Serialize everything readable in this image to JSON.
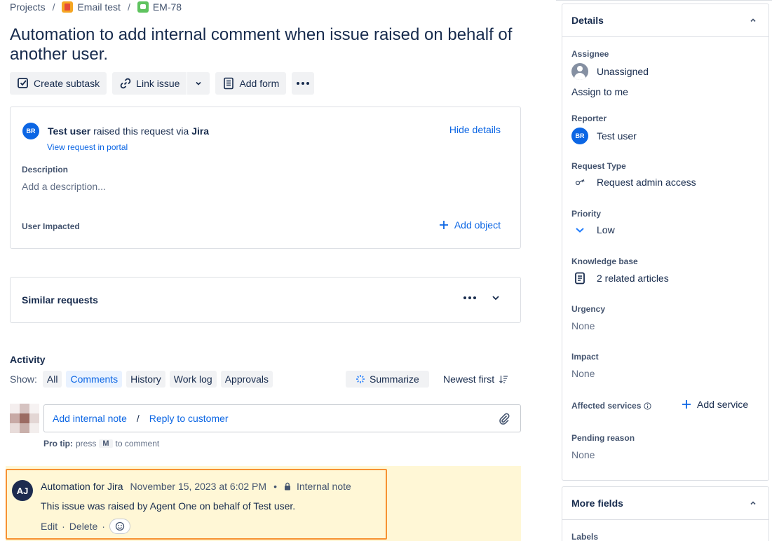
{
  "breadcrumb": {
    "projects": "Projects",
    "project": "Email test",
    "issue_key": "EM-78"
  },
  "issue": {
    "title": "Automation to add internal comment when issue raised on behalf of another user."
  },
  "toolbar": {
    "create_subtask": "Create subtask",
    "link_issue": "Link issue",
    "add_form": "Add form"
  },
  "request": {
    "avatar_initials": "BR",
    "user": "Test user",
    "raised_text": "raised this request via",
    "channel": "Jira",
    "view_portal": "View request in portal",
    "hide_details": "Hide details",
    "description_label": "Description",
    "description_placeholder": "Add a description...",
    "user_impacted_label": "User Impacted",
    "add_object": "Add object"
  },
  "similar": {
    "title": "Similar requests"
  },
  "activity": {
    "label": "Activity",
    "show_label": "Show:",
    "filters": [
      "All",
      "Comments",
      "History",
      "Work log",
      "Approvals"
    ],
    "active_filter": "Comments",
    "summarize": "Summarize",
    "sort": "Newest first",
    "add_internal_note": "Add internal note",
    "separator": "/",
    "reply_to_customer": "Reply to customer",
    "pro_tip_label": "Pro tip:",
    "pro_tip_press": "press",
    "pro_tip_key": "M",
    "pro_tip_end": "to comment"
  },
  "comment": {
    "avatar_initials": "AJ",
    "author": "Automation for Jira",
    "date": "November 15, 2023 at 6:02 PM",
    "visibility": "Internal note",
    "body": "This issue was raised by Agent One on behalf of Test user.",
    "edit": "Edit",
    "delete": "Delete"
  },
  "details": {
    "header": "Details",
    "assignee_label": "Assignee",
    "assignee_value": "Unassigned",
    "assign_to_me": "Assign to me",
    "reporter_label": "Reporter",
    "reporter_initials": "BR",
    "reporter_value": "Test user",
    "request_type_label": "Request Type",
    "request_type_value": "Request admin access",
    "priority_label": "Priority",
    "priority_value": "Low",
    "kb_label": "Knowledge base",
    "kb_value": "2 related articles",
    "urgency_label": "Urgency",
    "urgency_value": "None",
    "impact_label": "Impact",
    "impact_value": "None",
    "affected_label": "Affected services",
    "add_service": "Add service",
    "pending_label": "Pending reason",
    "pending_value": "None"
  },
  "more_fields": {
    "header": "More fields",
    "labels_label": "Labels"
  },
  "colors": {
    "link": "#0c66e4",
    "highlight_bg": "#fff7d6",
    "highlight_border": "#f79232"
  }
}
